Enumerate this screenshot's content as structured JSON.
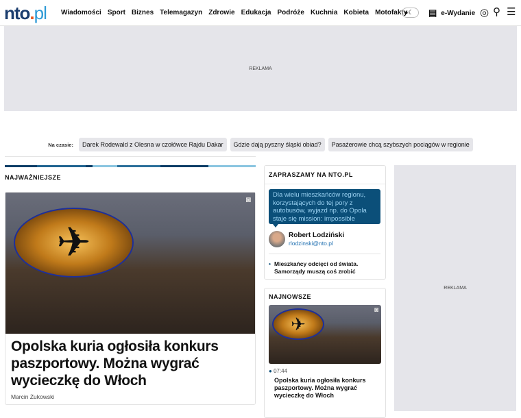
{
  "header": {
    "logo": {
      "main": "nto",
      "dot": ".",
      "suffix": "pl"
    },
    "nav": [
      "Wiadomości",
      "Sport",
      "Biznes",
      "Telemagazyn",
      "Zdrowie",
      "Edukacja",
      "Podróże",
      "Kuchnia",
      "Kobieta",
      "Motofakty"
    ],
    "eWydanie": "e-Wydanie"
  },
  "ads": {
    "top": "REKLAMA",
    "side": "REKLAMA"
  },
  "trending": {
    "label": "Na czasie:",
    "items": [
      "Darek Rodewald z Olesna w czołówce Rajdu Dakar",
      "Gdzie dają pyszny śląski obiad?",
      "Pasażerowie chcą szybszych pociągów w regionie"
    ]
  },
  "main": {
    "section": "NAJWAŻNIEJSZE",
    "article": {
      "title": "Opolska kuria ogłosiła konkurs paszportowy. Można wygrać wycieczkę do Włoch",
      "author": "Marcin Żukowski"
    }
  },
  "invite": {
    "title": "ZAPRASZAMY NA NTO.PL",
    "quote": "Dla wielu mieszkańców regionu, korzystających do tej pory z autobusów, wyjazd np. do Opola staje się mission: impossible",
    "author": "Robert Lodziński",
    "email": "rlodzinski@nto.pl",
    "link": "Mieszkańcy odcięci od świata. Samorządy muszą coś zrobić"
  },
  "latest": {
    "title": "NAJNOWSZE",
    "time": "07:44",
    "headline": "Opolska kuria ogłosiła konkurs paszportowy. Można wygrać wycieczkę do Włoch"
  },
  "colors": {
    "navy": "#0b4f79",
    "accent": "#e8561e"
  }
}
